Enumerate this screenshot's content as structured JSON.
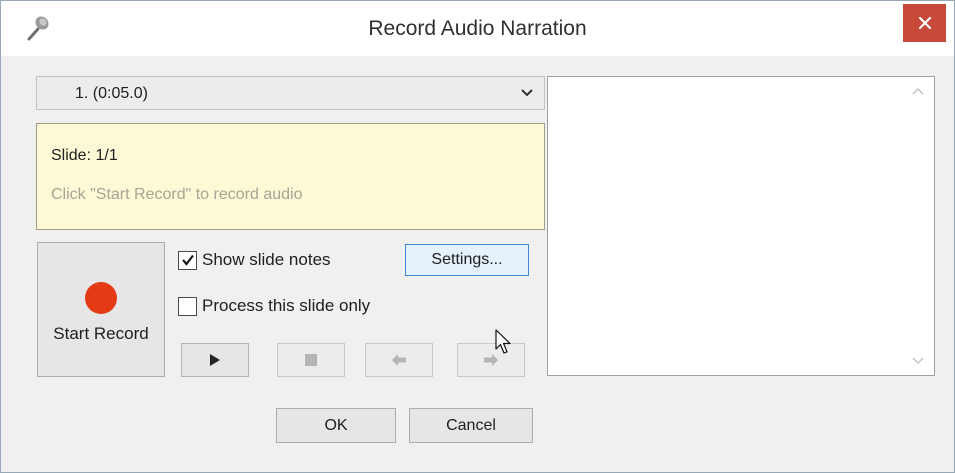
{
  "window": {
    "title": "Record Audio Narration",
    "icon": "microphone-icon",
    "close_icon": "close-icon",
    "accent_color": "#c7493a"
  },
  "slide_selector": {
    "selected": "1. (0:05.0)",
    "icon": "chevron-down-icon"
  },
  "notes": {
    "slide_label": "Slide: 1/1",
    "hint": "Click \"Start Record\" to record audio",
    "background_color": "#fdf9d7"
  },
  "record": {
    "label": "Start Record",
    "icon": "record-dot-icon",
    "icon_color": "#e53a16"
  },
  "options": {
    "show_notes_label": "Show slide notes",
    "show_notes_checked": true,
    "process_only_label": "Process this slide only",
    "process_only_checked": false,
    "settings_label": "Settings..."
  },
  "playback": {
    "play_icon": "play-icon",
    "stop_icon": "stop-icon",
    "prev_icon": "arrow-left-icon",
    "next_icon": "arrow-right-icon"
  },
  "footer": {
    "ok_label": "OK",
    "cancel_label": "Cancel"
  }
}
